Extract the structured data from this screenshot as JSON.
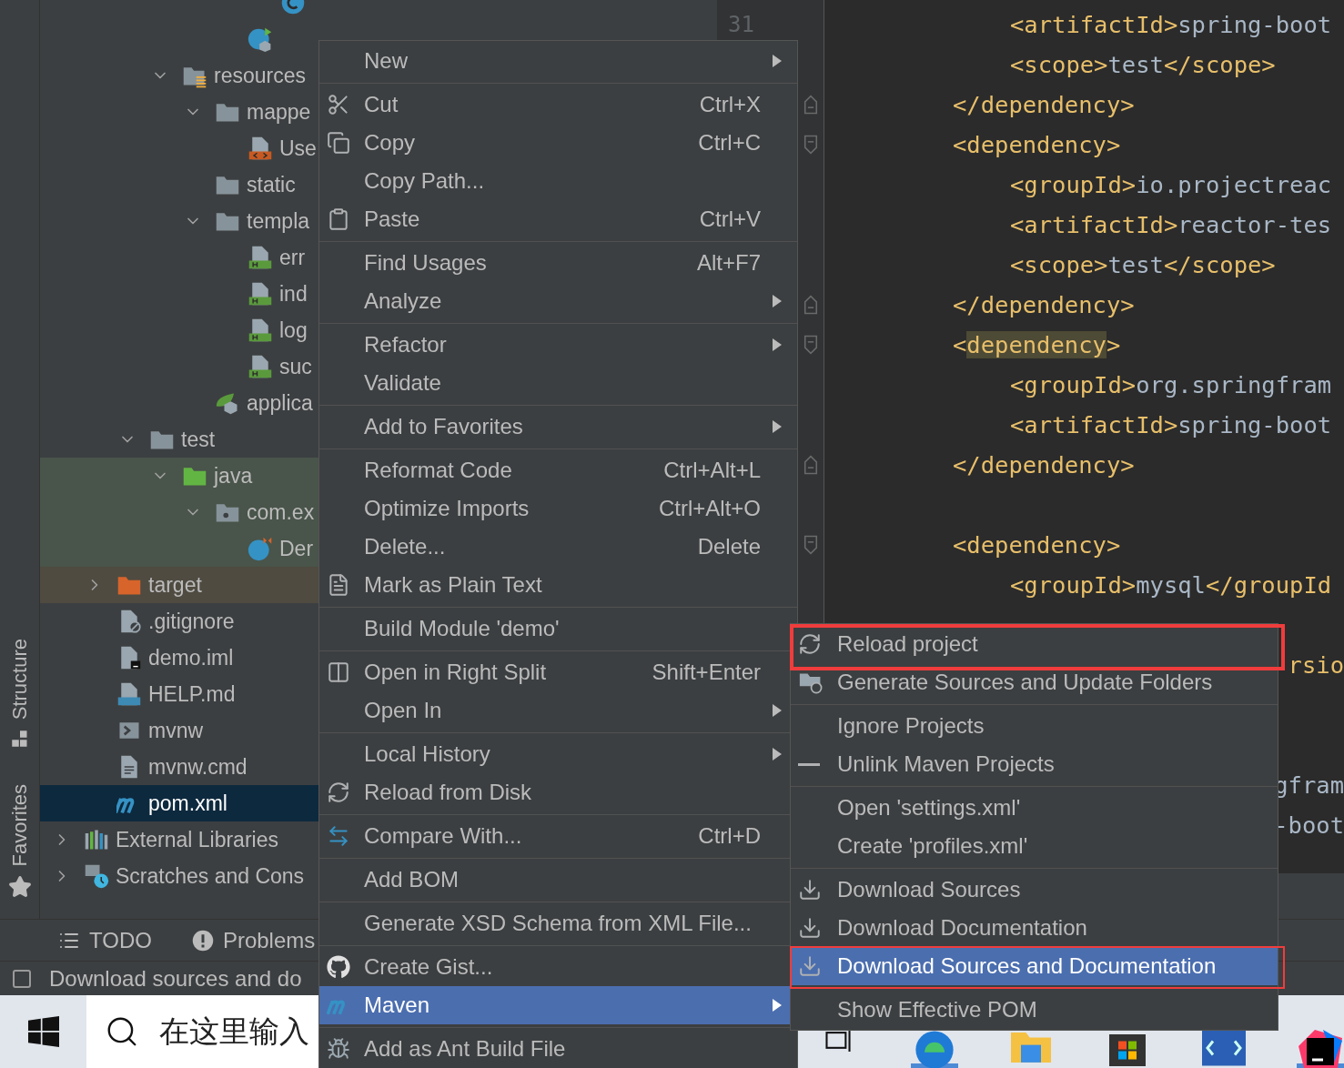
{
  "sidebar_tabs": [
    {
      "label": "Structure",
      "kind": "structure"
    },
    {
      "label": "Favorites",
      "kind": "favorites"
    }
  ],
  "project_tree": [
    {
      "children": [
        {
          "children": [
            {
              "children": [
                {
                  "children": [
                    {
                      "children": [
                        {
                          "children": [
                            {
                              "kind": "class"
                            }
                          ]
                        },
                        {
                          "kind": "springclass"
                        }
                      ]
                    }
                  ]
                },
                {
                  "label": "resources",
                  "kind": "resources",
                  "expanded": true,
                  "children": [
                    {
                      "label": "mappe",
                      "kind": "folder",
                      "expanded": true,
                      "children": [
                        {
                          "label": "Use",
                          "kind": "xml"
                        }
                      ]
                    },
                    {
                      "label": "static",
                      "kind": "folder"
                    },
                    {
                      "label": "templa",
                      "kind": "folder",
                      "expanded": true,
                      "children": [
                        {
                          "label": "err",
                          "kind": "html"
                        },
                        {
                          "label": "ind",
                          "kind": "html"
                        },
                        {
                          "label": "log",
                          "kind": "html"
                        },
                        {
                          "label": "suc",
                          "kind": "html"
                        }
                      ]
                    },
                    {
                      "label": "applica",
                      "kind": "springconfig"
                    }
                  ]
                }
              ]
            },
            {
              "label": "test",
              "kind": "folder",
              "expanded": true,
              "children": [
                {
                  "label": "java",
                  "kind": "testroot",
                  "expanded": true,
                  "test_source": true,
                  "children": [
                    {
                      "label": "com.ex",
                      "kind": "package",
                      "expanded": true,
                      "test_source": true,
                      "children": [
                        {
                          "label": "Der",
                          "kind": "testclass",
                          "test_source": true
                        }
                      ]
                    }
                  ]
                }
              ]
            }
          ]
        },
        {
          "label": "target",
          "kind": "excluded",
          "expanded": false,
          "excluded": true
        },
        {
          "label": ".gitignore",
          "kind": "gitignore"
        },
        {
          "label": "demo.iml",
          "kind": "iml"
        },
        {
          "label": "HELP.md",
          "kind": "markdown"
        },
        {
          "label": "mvnw",
          "kind": "script"
        },
        {
          "label": "mvnw.cmd",
          "kind": "textfile"
        },
        {
          "label": "pom.xml",
          "kind": "maven",
          "selected": true
        }
      ]
    },
    {
      "label": "External Libraries",
      "kind": "libraries",
      "expanded": false
    },
    {
      "label": "Scratches and Cons",
      "kind": "scratches",
      "expanded": false
    }
  ],
  "editor": {
    "lines": [
      {
        "kind": "inner",
        "number": "31",
        "parts": [
          {
            "kind": "tag",
            "text": "<artifactId>"
          },
          {
            "kind": "value",
            "text": "spring-boot"
          }
        ]
      },
      {
        "kind": "inner",
        "parts": [
          {
            "kind": "tag",
            "text": "<scope>"
          },
          {
            "kind": "value",
            "text": "test"
          },
          {
            "kind": "tag",
            "text": "</scope>"
          }
        ]
      },
      {
        "kind": "outer",
        "fold_end": true,
        "parts": [
          {
            "kind": "tag",
            "text": "</dependency>"
          }
        ]
      },
      {
        "kind": "outer",
        "fold_start": true,
        "parts": [
          {
            "kind": "tag",
            "text": "<dependency>"
          }
        ]
      },
      {
        "kind": "inner",
        "parts": [
          {
            "kind": "tag",
            "text": "<groupId>"
          },
          {
            "kind": "value",
            "text": "io.projectreac"
          }
        ]
      },
      {
        "kind": "inner",
        "parts": [
          {
            "kind": "tag",
            "text": "<artifactId>"
          },
          {
            "kind": "value",
            "text": "reactor-tes"
          }
        ]
      },
      {
        "kind": "inner",
        "parts": [
          {
            "kind": "tag",
            "text": "<scope>"
          },
          {
            "kind": "value",
            "text": "test"
          },
          {
            "kind": "tag",
            "text": "</scope>"
          }
        ]
      },
      {
        "kind": "outer",
        "fold_end": true,
        "parts": [
          {
            "kind": "tag",
            "text": "</dependency>"
          }
        ]
      },
      {
        "kind": "outer",
        "fold_start": true,
        "parts": [
          {
            "kind": "tag",
            "text": "<"
          },
          {
            "kind": "match",
            "text": "dependency"
          },
          {
            "kind": "tag",
            "text": ">"
          }
        ]
      },
      {
        "kind": "inner",
        "parts": [
          {
            "kind": "tag",
            "text": "<groupId>"
          },
          {
            "kind": "value",
            "text": "org.springfram"
          }
        ]
      },
      {
        "kind": "inner",
        "parts": [
          {
            "kind": "tag",
            "text": "<artifactId>"
          },
          {
            "kind": "value",
            "text": "spring-boot"
          }
        ]
      },
      {
        "kind": "outer",
        "fold_end": true,
        "parts": [
          {
            "kind": "tag",
            "text": "</dependency>"
          }
        ]
      },
      {
        "kind": "blank"
      },
      {
        "kind": "outer",
        "fold_start": true,
        "parts": [
          {
            "kind": "tag",
            "text": "<dependency>"
          }
        ]
      },
      {
        "kind": "inner",
        "parts": [
          {
            "kind": "tag",
            "text": "<groupId>"
          },
          {
            "kind": "value",
            "text": "mysql"
          },
          {
            "kind": "tag",
            "text": "</groupId"
          }
        ]
      },
      {
        "kind": "blank"
      },
      {
        "kind": "tail",
        "parts": [
          {
            "kind": "tag",
            "text": "rsio"
          }
        ]
      },
      {
        "kind": "blank"
      },
      {
        "kind": "blank"
      },
      {
        "kind": "tail",
        "parts": [
          {
            "kind": "value",
            "text": "gfram"
          }
        ]
      },
      {
        "kind": "tail",
        "parts": [
          {
            "kind": "value",
            "text": "-boot"
          }
        ]
      }
    ]
  },
  "tool_tabs": [
    {
      "label": "TODO",
      "kind": "todo"
    },
    {
      "label": "Problems",
      "kind": "problems"
    }
  ],
  "status_bar": {
    "message": "Download sources and do"
  },
  "taskbar": {
    "search_placeholder": "在这里输入"
  },
  "context_menu": {
    "groups": [
      [
        {
          "label": "New",
          "submenu": true,
          "selected": false
        }
      ],
      [
        {
          "label": "Cut",
          "shortcut": "Ctrl+X",
          "kind": "cut",
          "submenu": false,
          "selected": false
        },
        {
          "label": "Copy",
          "shortcut": "Ctrl+C",
          "kind": "copy",
          "submenu": false,
          "selected": false
        },
        {
          "label": "Copy Path...",
          "submenu": false,
          "selected": false
        },
        {
          "label": "Paste",
          "shortcut": "Ctrl+V",
          "kind": "paste",
          "submenu": false,
          "selected": false
        }
      ],
      [
        {
          "label": "Find Usages",
          "shortcut": "Alt+F7",
          "submenu": false,
          "selected": false
        },
        {
          "label": "Analyze",
          "submenu": true,
          "selected": false
        }
      ],
      [
        {
          "label": "Refactor",
          "submenu": true,
          "selected": false
        },
        {
          "label": "Validate",
          "submenu": false,
          "selected": false
        }
      ],
      [
        {
          "label": "Add to Favorites",
          "submenu": true,
          "selected": false
        }
      ],
      [
        {
          "label": "Reformat Code",
          "shortcut": "Ctrl+Alt+L",
          "submenu": false,
          "selected": false
        },
        {
          "label": "Optimize Imports",
          "shortcut": "Ctrl+Alt+O",
          "submenu": false,
          "selected": false
        },
        {
          "label": "Delete...",
          "shortcut": "Delete",
          "submenu": false,
          "selected": false
        },
        {
          "label": "Mark as Plain Text",
          "kind": "plaintext",
          "submenu": false,
          "selected": false
        }
      ],
      [
        {
          "label": "Build Module 'demo'",
          "submenu": false,
          "selected": false
        }
      ],
      [
        {
          "label": "Open in Right Split",
          "shortcut": "Shift+Enter",
          "kind": "split",
          "submenu": false,
          "selected": false
        },
        {
          "label": "Open In",
          "submenu": true,
          "selected": false
        }
      ],
      [
        {
          "label": "Local History",
          "submenu": true,
          "selected": false
        },
        {
          "label": "Reload from Disk",
          "kind": "reload",
          "submenu": false,
          "selected": false
        }
      ],
      [
        {
          "label": "Compare With...",
          "shortcut": "Ctrl+D",
          "kind": "compare",
          "submenu": false,
          "selected": false
        }
      ],
      [
        {
          "label": "Add BOM",
          "submenu": false,
          "selected": false
        }
      ],
      [
        {
          "label": "Generate XSD Schema from XML File...",
          "submenu": false,
          "selected": false
        }
      ],
      [
        {
          "label": "Create Gist...",
          "kind": "gist",
          "submenu": false,
          "selected": false
        },
        {
          "label": "Maven",
          "kind": "maven",
          "submenu": true,
          "selected": true
        }
      ],
      [
        {
          "label": "Add as Ant Build File",
          "kind": "ant",
          "submenu": false,
          "selected": false
        }
      ]
    ]
  },
  "maven_submenu": {
    "groups": [
      [
        {
          "label": "Reload project",
          "kind": "reload",
          "selected": false,
          "outlined": true
        },
        {
          "label": "Generate Sources and Update Folders",
          "kind": "generate",
          "selected": false,
          "outlined": false
        }
      ],
      [
        {
          "label": "Ignore Projects",
          "selected": false,
          "outlined": false
        },
        {
          "label": "Unlink Maven Projects",
          "kind": "unlink",
          "selected": false,
          "outlined": false
        }
      ],
      [
        {
          "label": "Open 'settings.xml'",
          "selected": false,
          "outlined": false
        },
        {
          "label": "Create 'profiles.xml'",
          "selected": false,
          "outlined": false
        }
      ],
      [
        {
          "label": "Download Sources",
          "kind": "download",
          "selected": false,
          "outlined": false
        },
        {
          "label": "Download Documentation",
          "kind": "download",
          "selected": false,
          "outlined": false
        },
        {
          "label": "Download Sources and Documentation",
          "kind": "download",
          "selected": true,
          "outlined": true
        }
      ],
      [
        {
          "label": "Show Effective POM",
          "selected": false,
          "outlined": false
        }
      ]
    ]
  }
}
